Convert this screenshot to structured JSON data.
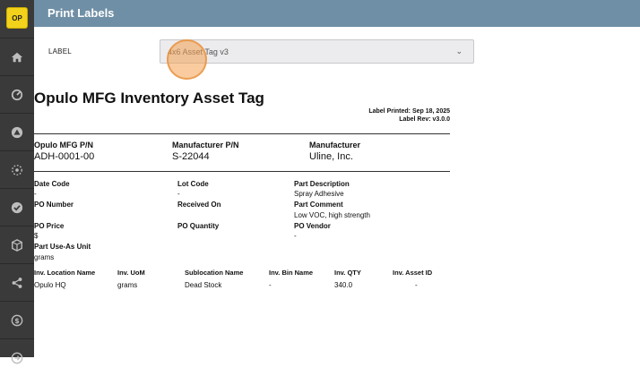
{
  "logo": "OP",
  "header": {
    "title": "Print Labels"
  },
  "form": {
    "label_caption": "LABEL",
    "label_value": "4x6 Asset Tag v3"
  },
  "tag": {
    "title": "Opulo MFG Inventory Asset Tag",
    "printed": "Label Printed: Sep 18, 2025",
    "rev": "Label Rev: v3.0.0",
    "top": [
      {
        "label": "Opulo MFG P/N",
        "value": "ADH-0001-00"
      },
      {
        "label": "Manufacturer P/N",
        "value": "S-22044"
      },
      {
        "label": "Manufacturer",
        "value": "Uline, Inc."
      }
    ],
    "fields": {
      "date_code": {
        "label": "Date Code",
        "value": "-"
      },
      "lot_code": {
        "label": "Lot Code",
        "value": "-"
      },
      "part_description": {
        "label": "Part Description",
        "value": "Spray Adhesive"
      },
      "po_number": {
        "label": "PO Number",
        "value": ""
      },
      "received_on": {
        "label": "Received On",
        "value": ""
      },
      "part_comment": {
        "label": "Part Comment",
        "value": "Low VOC, high strength"
      },
      "po_price": {
        "label": "PO Price",
        "value": "$"
      },
      "po_quantity": {
        "label": "PO Quantity",
        "value": ""
      },
      "po_vendor": {
        "label": "PO Vendor",
        "value": "-"
      },
      "part_use_as_unit": {
        "label": "Part Use-As Unit",
        "value": "grams"
      }
    },
    "table": {
      "headers": [
        "Inv. Location Name",
        "Inv. UoM",
        "Sublocation Name",
        "Inv. Bin Name",
        "Inv. QTY",
        "Inv. Asset ID"
      ],
      "row": [
        "Opulo HQ",
        "grams",
        "Dead Stock",
        "-",
        "340.0",
        "-"
      ]
    }
  }
}
